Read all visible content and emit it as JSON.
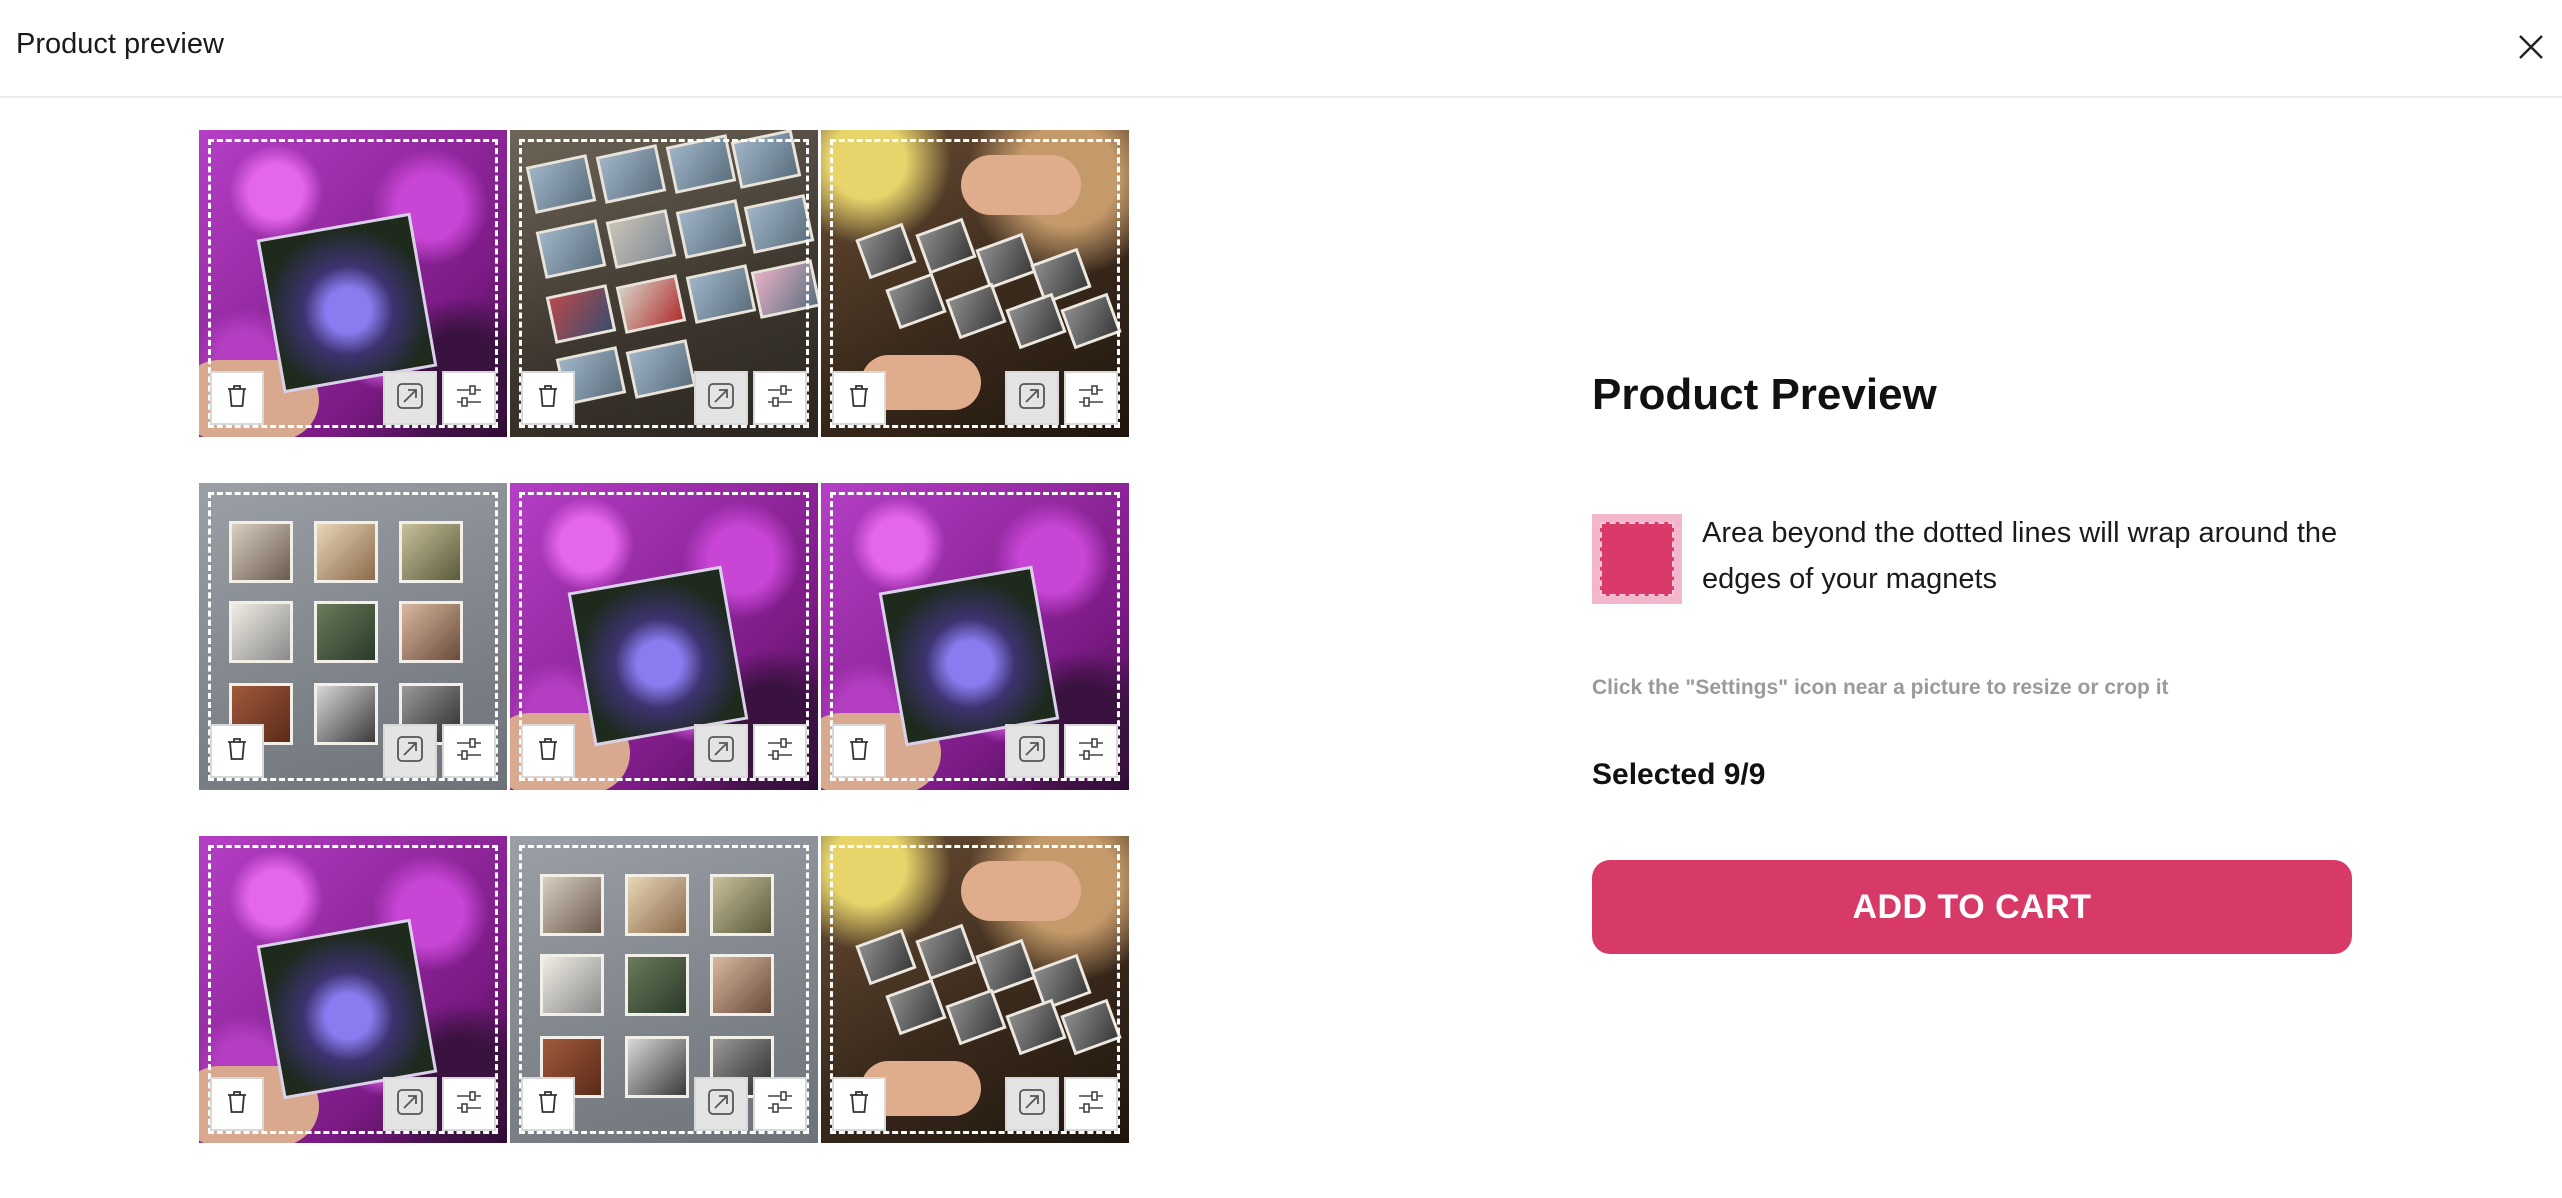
{
  "header": {
    "title": "Product preview",
    "close_icon": "close-icon"
  },
  "tiles": [
    {
      "photo": "purple-flower-magnet",
      "tools": [
        "trash-icon",
        "crop-icon",
        "settings-icon"
      ]
    },
    {
      "photo": "magnet-board",
      "tools": [
        "trash-icon",
        "crop-icon",
        "settings-icon"
      ]
    },
    {
      "photo": "child-hand-magnets",
      "tools": [
        "trash-icon",
        "crop-icon",
        "settings-icon"
      ]
    },
    {
      "photo": "gray-wall-magnets",
      "tools": [
        "trash-icon",
        "crop-icon",
        "settings-icon"
      ]
    },
    {
      "photo": "purple-flower-magnet",
      "tools": [
        "trash-icon",
        "crop-icon",
        "settings-icon"
      ]
    },
    {
      "photo": "purple-flower-magnet",
      "tools": [
        "trash-icon",
        "crop-icon",
        "settings-icon"
      ]
    },
    {
      "photo": "purple-flower-magnet",
      "tools": [
        "trash-icon",
        "crop-icon",
        "settings-icon"
      ]
    },
    {
      "photo": "gray-wall-magnets",
      "tools": [
        "trash-icon",
        "crop-icon",
        "settings-icon"
      ]
    },
    {
      "photo": "child-hand-magnets",
      "tools": [
        "trash-icon",
        "crop-icon",
        "settings-icon"
      ]
    }
  ],
  "panel": {
    "title": "Product Preview",
    "legend_text": "Area beyond the dotted lines will wrap around the edges of your magnets",
    "hint": "Click the \"Settings\" icon near a picture to resize or crop it",
    "selected": "Selected 9/9",
    "add_to_cart": "ADD TO CART"
  },
  "colors": {
    "accent": "#d83a68",
    "swatch_outer": "#f2b7cd",
    "swatch_inner": "#d93a6a",
    "hint": "#9a9a9a"
  }
}
